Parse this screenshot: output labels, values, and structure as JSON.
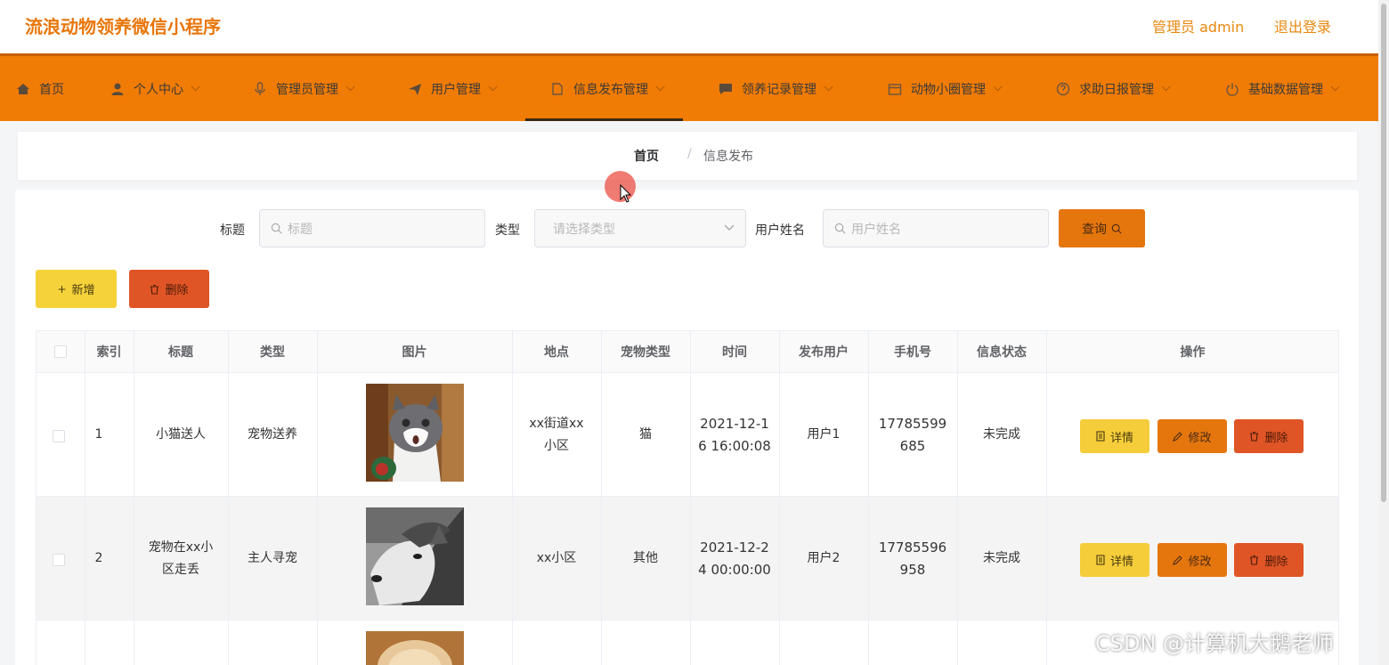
{
  "header": {
    "app_title": "流浪动物领养微信小程序",
    "admin_label": "管理员 admin",
    "logout": "退出登录"
  },
  "nav": {
    "items": [
      {
        "label": "首页",
        "icon": "home-icon"
      },
      {
        "label": "个人中心",
        "icon": "user-icon"
      },
      {
        "label": "管理员管理",
        "icon": "microphone-icon"
      },
      {
        "label": "用户管理",
        "icon": "send-icon"
      },
      {
        "label": "信息发布管理",
        "icon": "document-icon"
      },
      {
        "label": "领养记录管理",
        "icon": "chat-icon"
      },
      {
        "label": "动物小圈管理",
        "icon": "calendar-icon"
      },
      {
        "label": "求助日报管理",
        "icon": "help-icon"
      },
      {
        "label": "基础数据管理",
        "icon": "power-icon"
      }
    ],
    "active_index": 4
  },
  "breadcrumb": {
    "home": "首页",
    "separator": "/",
    "current": "信息发布"
  },
  "search": {
    "title_label": "标题",
    "title_placeholder": "标题",
    "type_label": "类型",
    "type_placeholder": "请选择类型",
    "username_label": "用户姓名",
    "username_placeholder": "用户姓名",
    "query_button": "查询"
  },
  "actions": {
    "add": "新增",
    "delete": "删除"
  },
  "table": {
    "columns": [
      "索引",
      "标题",
      "类型",
      "图片",
      "地点",
      "宠物类型",
      "时间",
      "发布用户",
      "手机号",
      "信息状态",
      "操作"
    ],
    "rows": [
      {
        "index": "1",
        "title": "小猫送人",
        "type": "宠物送养",
        "image": "cat-photo",
        "location": "xx街道xx\n小区",
        "pet_type": "猫",
        "time": "2021-12-1\n6 16:00:08",
        "user": "用户1",
        "phone": "17785599\n685",
        "status": "未完成"
      },
      {
        "index": "2",
        "title": "宠物在xx小\n区走丢",
        "type": "主人寻宠",
        "image": "husky-photo",
        "location": "xx小区",
        "pet_type": "其他",
        "time": "2021-12-2\n4 00:00:00",
        "user": "用户2",
        "phone": "17785596\n958",
        "status": "未完成"
      }
    ],
    "row_buttons": {
      "detail": "详情",
      "edit": "修改",
      "delete": "删除"
    }
  },
  "watermark": "CSDN @计算机大鹅老师",
  "colors": {
    "accent": "#f07b05",
    "title": "#e8760a",
    "detail_btn": "#f5cd3a",
    "edit_btn": "#e5760e",
    "delete_btn": "#e05526",
    "add_btn": "#f5d23a"
  }
}
